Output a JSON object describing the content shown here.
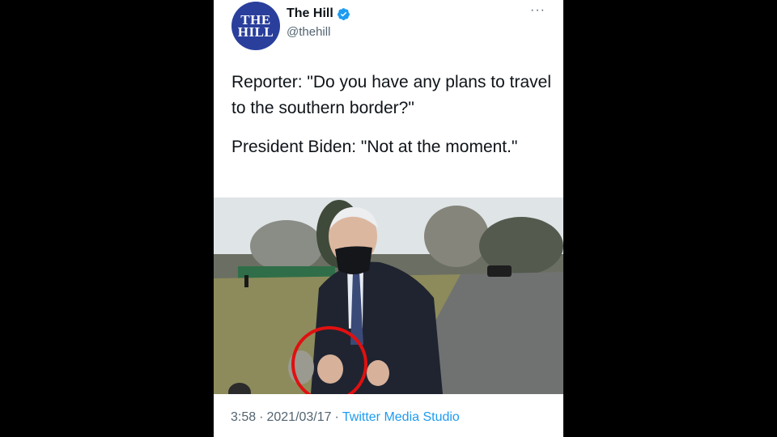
{
  "tweet": {
    "avatar_text": [
      "THE",
      "HILL"
    ],
    "name": "The Hill",
    "handle": "@thehill",
    "more_label": "···",
    "text_lines": [
      "Reporter: \"Do you have any plans to travel to the southern border?\"",
      "President Biden: \"Not at the moment.\""
    ],
    "time": "3:58",
    "date": "2021/03/17",
    "separator": "·",
    "source": "Twitter Media Studio"
  },
  "colors": {
    "avatar_bg": "#2a3f9c",
    "verified": "#1d9bf0",
    "link": "#1d9bf0",
    "highlight_circle": "#e01010"
  },
  "icons": [
    "verified-badge-icon",
    "more-options-icon"
  ]
}
